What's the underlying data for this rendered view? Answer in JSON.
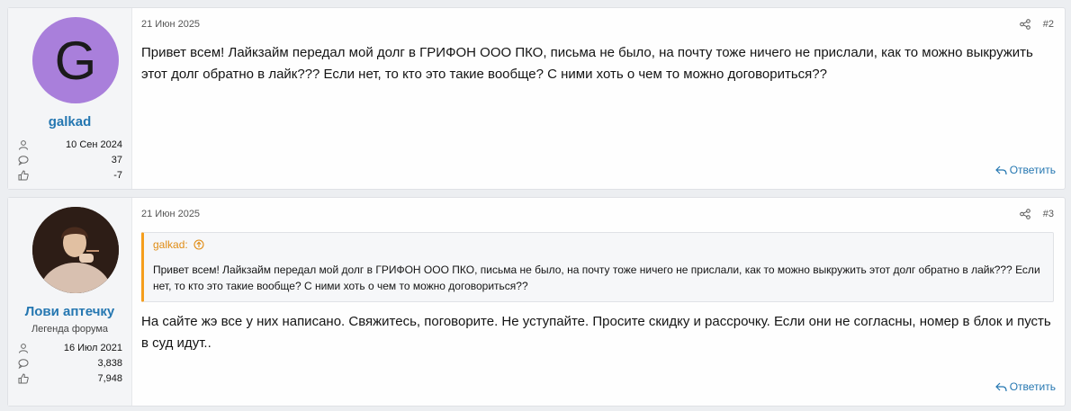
{
  "posts": [
    {
      "user": {
        "avatar_letter": "G",
        "name": "galkad",
        "title": "",
        "joined": "10 Сен 2024",
        "messages": "37",
        "reactions": "-7"
      },
      "date": "21 Июн 2025",
      "number": "#2",
      "text": "Привет всем! Лайкзайм передал мой долг в ГРИФОН ООО ПКО, письма не было, на почту тоже ничего не прислали, как то можно выкружить этот долг обратно в лайк??? Если нет, то кто это такие вообще? С ними хоть о чем то можно договориться??",
      "reply_label": "Ответить"
    },
    {
      "user": {
        "name": "Лови аптечку",
        "title": "Легенда форума",
        "joined": "16 Июл 2021",
        "messages": "3,838",
        "reactions": "7,948"
      },
      "date": "21 Июн 2025",
      "number": "#3",
      "quote": {
        "author": "galkad:",
        "text": "Привет всем! Лайкзайм передал мой долг в ГРИФОН ООО ПКО, письма не было, на почту тоже ничего не прислали, как то можно выкружить этот долг обратно в лайк??? Если нет, то кто это такие вообще? С ними хоть о чем то можно договориться??"
      },
      "text": "На сайте жэ все у них написано. Свяжитесь, поговорите. Не уступайте. Просите скидку и рассрочку. Если они не согласны, номер в блок и пусть в суд идут..",
      "reply_label": "Ответить"
    }
  ],
  "colors": {
    "accent": "#2577b1",
    "quote_accent": "#f59e1c",
    "avatar_bg": "#a97fdb"
  }
}
